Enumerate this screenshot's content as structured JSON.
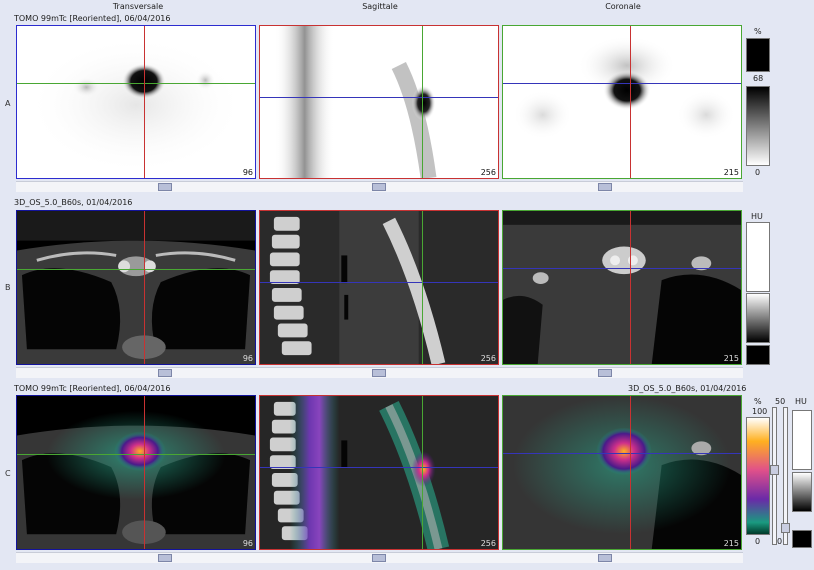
{
  "headers": {
    "transversale": "Transversale",
    "sagittale": "Sagittale",
    "coronale": "Coronale"
  },
  "rows": {
    "a": {
      "label": "A",
      "title": "TOMO 99mTc [Reoriented], 06/04/2016"
    },
    "b": {
      "label": "B",
      "title": "3D_OS_5.0_B60s, 01/04/2016"
    },
    "c": {
      "label": "C",
      "title_left": "TOMO 99mTc [Reoriented], 06/04/2016",
      "title_right": "3D_OS_5.0_B60s, 01/04/2016"
    }
  },
  "slices": {
    "transversale": "96",
    "sagittale": "256",
    "coronale": "215"
  },
  "scale_a": {
    "unit": "%",
    "mid": "68",
    "min": "0"
  },
  "scale_b": {
    "unit": "HU"
  },
  "scale_c": {
    "unit": "%",
    "max": "100",
    "min": "0",
    "right_unit": "HU",
    "val50": "50",
    "zero": "0"
  },
  "colors": {
    "red": "#c83232",
    "green": "#49a733",
    "blue": "#3535b9",
    "navy": "#13139b"
  }
}
